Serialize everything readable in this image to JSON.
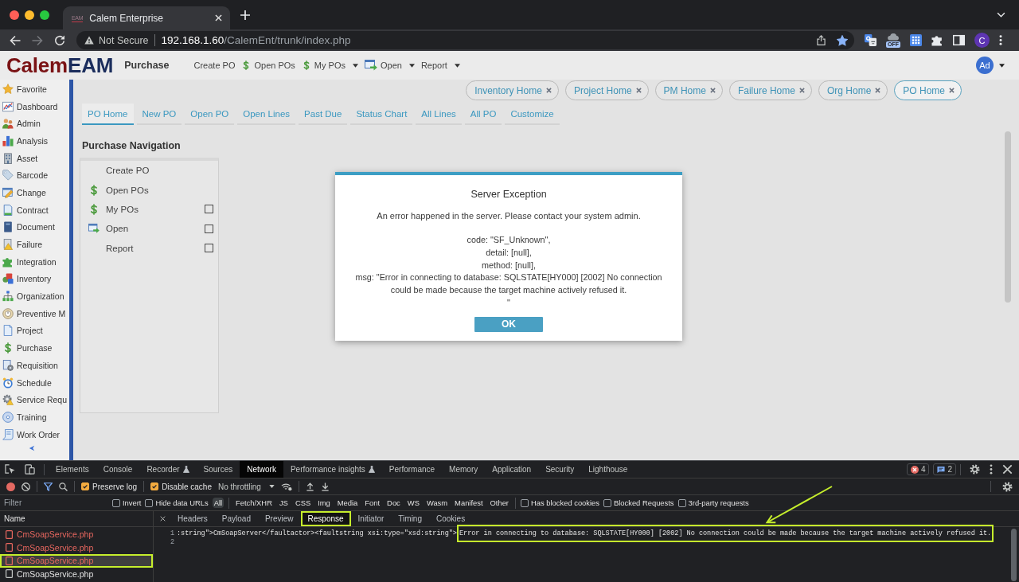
{
  "browser": {
    "favicon_text": "EAM",
    "tab_title": "Calem Enterprise",
    "forward_disabled": true,
    "security_label": "Not Secure",
    "url_host": "192.168.1.60",
    "url_path": "/CalemEnt/trunk/index.php",
    "bookmarked": true,
    "extension_badge": "OFF",
    "profile_initial": "C"
  },
  "app_header": {
    "logo_part_1": "Calem",
    "logo_part_2": "EAM",
    "module": "Purchase",
    "menu": [
      {
        "label": "Create PO",
        "dropdown": false
      },
      {
        "label": "Open POs",
        "dropdown": false
      },
      {
        "label": "My POs",
        "dropdown": true
      },
      {
        "label": "Open",
        "dropdown": true
      },
      {
        "label": "Report",
        "dropdown": true
      }
    ],
    "user_initials": "Ad"
  },
  "sidebar": {
    "items": [
      "Favorite",
      "Dashboard",
      "Admin",
      "Analysis",
      "Asset",
      "Barcode",
      "Change",
      "Contract",
      "Document",
      "Failure",
      "Integration",
      "Inventory",
      "Organization",
      "Preventive M",
      "Project",
      "Purchase",
      "Requisition",
      "Schedule",
      "Service Requ",
      "Training",
      "Work Order"
    ]
  },
  "open_tabs": [
    {
      "label": "Inventory Home",
      "selected": false
    },
    {
      "label": "Project Home",
      "selected": false
    },
    {
      "label": "PM Home",
      "selected": false
    },
    {
      "label": "Failure Home",
      "selected": false
    },
    {
      "label": "Org Home",
      "selected": false
    },
    {
      "label": "PO Home",
      "selected": true
    }
  ],
  "page_tabs": [
    {
      "label": "PO Home",
      "selected": true
    },
    {
      "label": "New PO",
      "selected": false
    },
    {
      "label": "Open PO",
      "selected": false
    },
    {
      "label": "Open Lines",
      "selected": false
    },
    {
      "label": "Past Due",
      "selected": false
    },
    {
      "label": "Status Chart",
      "selected": false
    },
    {
      "label": "All Lines",
      "selected": false
    },
    {
      "label": "All PO",
      "selected": false
    },
    {
      "label": "Customize",
      "selected": false
    }
  ],
  "navigation": {
    "title": "Purchase Navigation",
    "items": [
      {
        "label": "Create PO"
      },
      {
        "label": "Open POs"
      },
      {
        "label": "My POs",
        "checked": false
      },
      {
        "label": "Open",
        "checked": false
      },
      {
        "label": "Report",
        "checked": false
      }
    ]
  },
  "dialog": {
    "title": "Server Exception",
    "message": "An error happened in the server. Please contact your system admin.",
    "details": [
      "code: \"SF_Unknown\",",
      "detail: [null],",
      "method: [null],",
      "msg: \"Error in connecting to database: SQLSTATE[HY000] [2002] No connection could be made because the target machine actively refused it.",
      "\""
    ],
    "button": "OK"
  },
  "devtools": {
    "tabs": [
      {
        "label": "Elements",
        "selected": false,
        "experimental": false
      },
      {
        "label": "Console",
        "selected": false,
        "experimental": false
      },
      {
        "label": "Recorder",
        "selected": false,
        "experimental": true
      },
      {
        "label": "Sources",
        "selected": false,
        "experimental": false
      },
      {
        "label": "Network",
        "selected": true,
        "experimental": false
      },
      {
        "label": "Performance insights",
        "selected": false,
        "experimental": true
      },
      {
        "label": "Performance",
        "selected": false,
        "experimental": false
      },
      {
        "label": "Memory",
        "selected": false,
        "experimental": false
      },
      {
        "label": "Application",
        "selected": false,
        "experimental": false
      },
      {
        "label": "Security",
        "selected": false,
        "experimental": false
      },
      {
        "label": "Lighthouse",
        "selected": false,
        "experimental": false
      }
    ],
    "error_count": "4",
    "message_count": "2",
    "toolbar": {
      "recording": true,
      "options": [
        {
          "label": "Preserve log",
          "checked": true
        },
        {
          "label": "Disable cache",
          "checked": true
        }
      ],
      "throttling": "No throttling"
    },
    "filter": {
      "placeholder": "Filter",
      "options": [
        {
          "label": "Invert",
          "checked": false
        },
        {
          "label": "Hide data URLs",
          "checked": false
        }
      ],
      "types": [
        {
          "label": "All",
          "selected": true
        },
        {
          "label": "Fetch/XHR",
          "selected": false
        },
        {
          "label": "JS",
          "selected": false
        },
        {
          "label": "CSS",
          "selected": false
        },
        {
          "label": "Img",
          "selected": false
        },
        {
          "label": "Media",
          "selected": false
        },
        {
          "label": "Font",
          "selected": false
        },
        {
          "label": "Doc",
          "selected": false
        },
        {
          "label": "WS",
          "selected": false
        },
        {
          "label": "Wasm",
          "selected": false
        },
        {
          "label": "Manifest",
          "selected": false
        },
        {
          "label": "Other",
          "selected": false
        }
      ],
      "more_options": [
        {
          "label": "Has blocked cookies",
          "checked": false
        },
        {
          "label": "Blocked Requests",
          "checked": false
        },
        {
          "label": "3rd-party requests",
          "checked": false
        }
      ]
    },
    "list_header": "Name",
    "requests": [
      {
        "name": "CmSoapService.php",
        "failed": true,
        "selected": false,
        "highlighted": false
      },
      {
        "name": "CmSoapService.php",
        "failed": true,
        "selected": false,
        "highlighted": false
      },
      {
        "name": "CmSoapService.php",
        "failed": true,
        "selected": true,
        "highlighted": true
      },
      {
        "name": "CmSoapService.php",
        "failed": false,
        "selected": false,
        "highlighted": false
      }
    ],
    "detail_tabs": [
      {
        "label": "Headers",
        "selected": false,
        "highlighted": false
      },
      {
        "label": "Payload",
        "selected": false,
        "highlighted": false
      },
      {
        "label": "Preview",
        "selected": false,
        "highlighted": false
      },
      {
        "label": "Response",
        "selected": true,
        "highlighted": true
      },
      {
        "label": "Initiator",
        "selected": false,
        "highlighted": false
      },
      {
        "label": "Timing",
        "selected": false,
        "highlighted": false
      },
      {
        "label": "Cookies",
        "selected": false,
        "highlighted": false
      }
    ],
    "response_lines": [
      {
        "number": "1",
        "segments": [
          {
            "text": ":string\">CmSoapServer</faultactor><faultstring xsi:type=\"xsd:string\">",
            "highlighted": false
          },
          {
            "text": "Error in connecting to database: SQLSTATE[HY000] [2002] No connection could be made because the target machine actively refused it.",
            "highlighted": true
          }
        ]
      },
      {
        "number": "2"
      }
    ]
  }
}
